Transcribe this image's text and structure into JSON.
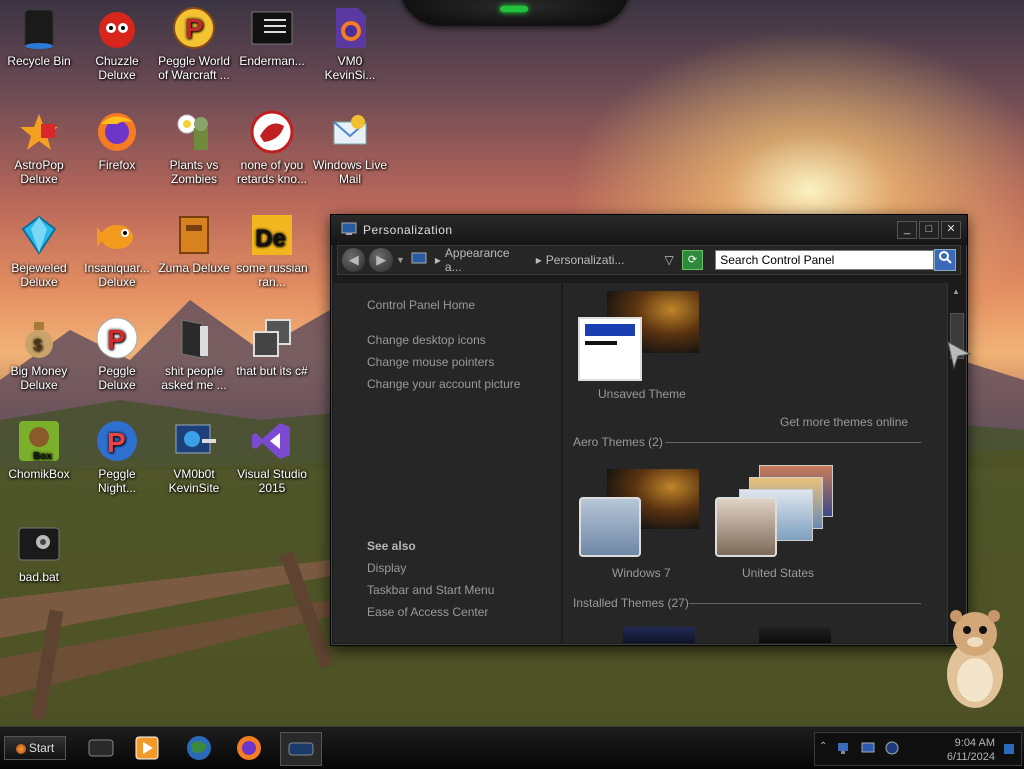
{
  "desktop": {
    "icons": [
      {
        "label": "Recycle Bin"
      },
      {
        "label": "Chuzzle Deluxe"
      },
      {
        "label": "Peggle World of Warcraft ..."
      },
      {
        "label": "Enderman..."
      },
      {
        "label": "VM0 KevinSi..."
      },
      {
        "label": "AstroPop Deluxe"
      },
      {
        "label": "Firefox"
      },
      {
        "label": "Plants vs Zombies"
      },
      {
        "label": "none of you retards kno..."
      },
      {
        "label": "Windows Live Mail"
      },
      {
        "label": "Bejeweled Deluxe"
      },
      {
        "label": "Insaniquar... Deluxe"
      },
      {
        "label": "Zuma Deluxe"
      },
      {
        "label": "some russian ran..."
      },
      {
        "label": "Big Money Deluxe"
      },
      {
        "label": "Peggle Deluxe"
      },
      {
        "label": "shit people asked me ..."
      },
      {
        "label": "that but its c#"
      },
      {
        "label": "ChomikBox"
      },
      {
        "label": "Peggle Night..."
      },
      {
        "label": "VM0b0t KevinSite"
      },
      {
        "label": "Visual Studio 2015"
      },
      {
        "label": "bad.bat"
      }
    ]
  },
  "window": {
    "title": "Personalization",
    "breadcrumb": {
      "part1": "Appearance a...",
      "part2": "Personalizati..."
    },
    "search_placeholder": "Search Control Panel",
    "left": {
      "home": "Control Panel Home",
      "links": [
        "Change desktop icons",
        "Change mouse pointers",
        "Change your account picture"
      ],
      "see_also_heading": "See also",
      "see_also": [
        "Display",
        "Taskbar and Start Menu",
        "Ease of Access Center"
      ]
    },
    "right": {
      "unsaved_theme": "Unsaved Theme",
      "get_more": "Get more themes online",
      "aero_heading": "Aero Themes (2)",
      "aero": [
        "Windows 7",
        "United States"
      ],
      "installed_heading": "Installed Themes (27)"
    }
  },
  "taskbar": {
    "start_label": "Start",
    "time": "9:04 AM",
    "date": "6/11/2024"
  }
}
